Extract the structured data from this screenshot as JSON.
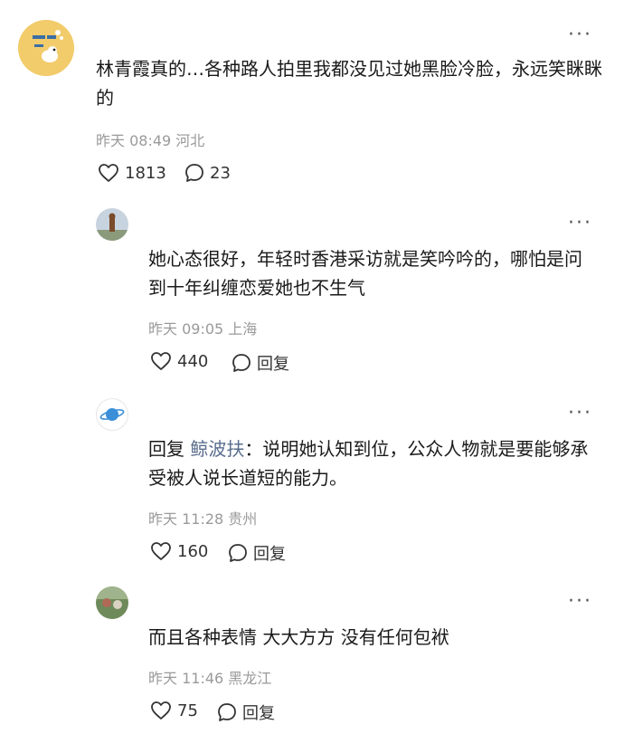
{
  "comments": [
    {
      "text": "林青霞真的…各种路人拍里我都没见过她黑脸冷脸，永远笑眯眯的",
      "time": "昨天 08:49",
      "location": "河北",
      "likes": "1813",
      "replies": "23",
      "avatar_colors": [
        "#f2cc6b",
        "#ffffff"
      ]
    },
    {
      "text": "她心态很好，年轻时香港采访就是笑吟吟的，哪怕是问到十年纠缠恋爱她也不生气",
      "time": "昨天 09:05",
      "location": "上海",
      "likes": "440",
      "reply_label": "回复"
    },
    {
      "reply_prefix": "回复",
      "reply_to": "鲸波扶",
      "text": "：说明她认知到位，公众人物就是要能够承受被人说长道短的能力。",
      "time": "昨天 11:28",
      "location": "贵州",
      "likes": "160",
      "reply_label": "回复"
    },
    {
      "text": "而且各种表情 大大方方 没有任何包袱",
      "time": "昨天 11:46",
      "location": "黑龙江",
      "likes": "75",
      "reply_label": "回复"
    }
  ],
  "more_glyph": "···"
}
